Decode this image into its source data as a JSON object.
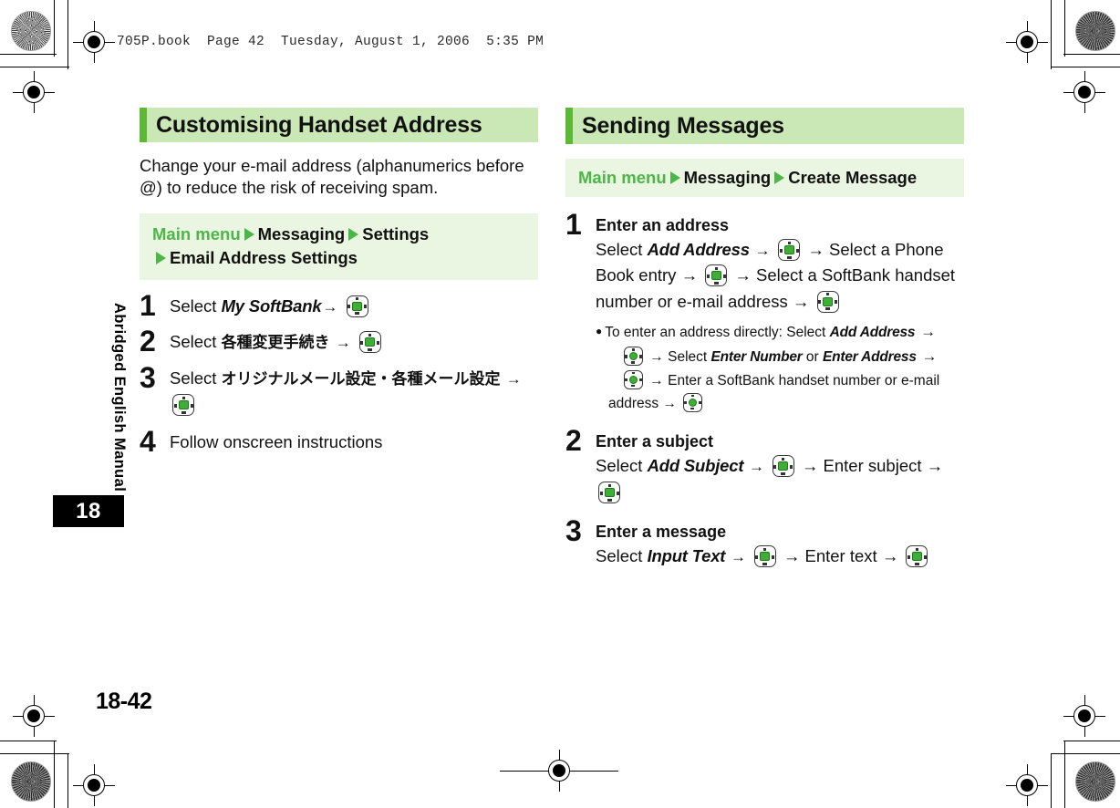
{
  "printer_marks": {
    "file_stamp": "705P.book  Page 42  Tuesday, August 1, 2006  5:35 PM"
  },
  "side_tab": {
    "label": "Abridged English Manual",
    "chapter_number": "18"
  },
  "folio": "18-42",
  "left_column": {
    "section_title": "Customising Handset Address",
    "intro": "Change your e-mail address (alphanumerics before @) to reduce the risk of receiving spam.",
    "nav_path": {
      "root": "Main menu",
      "items": [
        "Messaging",
        "Settings",
        "Email Address Settings"
      ]
    },
    "steps": [
      {
        "num": "1",
        "select_label": "Select",
        "target": "My SoftBank",
        "arrow": "→",
        "key_icon": "navigation-key-icon"
      },
      {
        "num": "2",
        "select_label": "Select",
        "target": "各種変更手続き",
        "arrow": "→",
        "key_icon": "navigation-key-icon"
      },
      {
        "num": "3",
        "select_label": "Select",
        "target": "オリジナルメール設定・各種メール設定",
        "arrow": "→",
        "key_icon": "navigation-key-icon"
      },
      {
        "num": "4",
        "text": "Follow onscreen instructions"
      }
    ]
  },
  "right_column": {
    "section_title": "Sending Messages",
    "nav_path": {
      "root": "Main menu",
      "items": [
        "Messaging",
        "Create Message"
      ]
    },
    "steps": [
      {
        "num": "1",
        "heading": "Enter an address",
        "line_parts": [
          "Select ",
          "Add Address",
          " → ",
          "[key]",
          " → Select a Phone Book entry → ",
          "[key]",
          " → Select a SoftBank handset number or e-mail address → ",
          "[key]"
        ],
        "note": {
          "bullet": "●",
          "text_1": "To enter an address directly: Select ",
          "em_1": "Add Address",
          "text_2": " → ",
          "text_3": " → Select ",
          "em_2": "Enter Number",
          "text_4": " or ",
          "em_3": "Enter Address",
          "text_5": " → ",
          "text_6": " → Enter a SoftBank handset number or e-mail address → "
        }
      },
      {
        "num": "2",
        "heading": "Enter a subject",
        "select_label": "Select ",
        "em": "Add Subject",
        "mid": " → Enter subject → "
      },
      {
        "num": "3",
        "heading": "Enter a message",
        "select_label": "Select ",
        "em": "Input Text",
        "mid": " → Enter text → "
      }
    ]
  },
  "colors": {
    "header_bg": "#c9e8b5",
    "header_accent": "#5bb935",
    "nav_bg": "#eaf6e1",
    "nav_green_text": "#4cb648",
    "key_green": "#3fae36"
  }
}
